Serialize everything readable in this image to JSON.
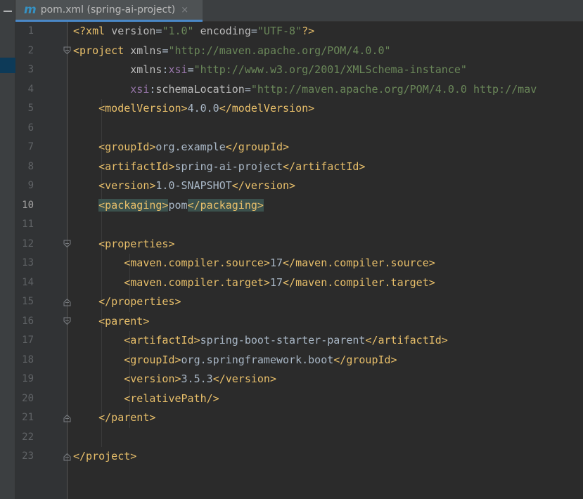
{
  "tab": {
    "icon": "maven-m-icon",
    "icon_glyph": "m",
    "label": "pom.xml (spring-ai-project)",
    "close_glyph": "×"
  },
  "colors": {
    "background": "#2b2b2b",
    "tag": "#e8bf6a",
    "attribute": "#bababa",
    "namespace": "#9876aa",
    "value": "#6a8759",
    "text": "#a9b7c6",
    "tag_match_highlight": "#3b514d",
    "tab_underline": "#4a88c7"
  },
  "editor": {
    "current_line": 10,
    "lines": [
      {
        "num": "1",
        "tokens": [
          {
            "t": "pi",
            "v": "<?xml "
          },
          {
            "t": "attr",
            "v": "version"
          },
          {
            "t": "txt",
            "v": "="
          },
          {
            "t": "val",
            "v": "\"1.0\""
          },
          {
            "t": "txt",
            "v": " "
          },
          {
            "t": "attr",
            "v": "encoding"
          },
          {
            "t": "txt",
            "v": "="
          },
          {
            "t": "val",
            "v": "\"UTF-8\""
          },
          {
            "t": "pi",
            "v": "?>"
          }
        ]
      },
      {
        "num": "2",
        "fold": "open",
        "tokens": [
          {
            "t": "tag",
            "v": "<project "
          },
          {
            "t": "attr",
            "v": "xmlns"
          },
          {
            "t": "txt",
            "v": "="
          },
          {
            "t": "val",
            "v": "\"http://maven.apache.org/POM/4.0.0\""
          }
        ]
      },
      {
        "num": "3",
        "tokens": [
          {
            "t": "txt",
            "v": "         "
          },
          {
            "t": "attr",
            "v": "xmlns"
          },
          {
            "t": "txt",
            "v": ":"
          },
          {
            "t": "ns",
            "v": "xsi"
          },
          {
            "t": "txt",
            "v": "="
          },
          {
            "t": "val",
            "v": "\"http://www.w3.org/2001/XMLSchema-instance\""
          }
        ]
      },
      {
        "num": "4",
        "tokens": [
          {
            "t": "txt",
            "v": "         "
          },
          {
            "t": "ns",
            "v": "xsi"
          },
          {
            "t": "txt",
            "v": ":"
          },
          {
            "t": "attr",
            "v": "schemaLocation"
          },
          {
            "t": "txt",
            "v": "="
          },
          {
            "t": "val",
            "v": "\"http://maven.apache.org/POM/4.0.0 http://mav"
          }
        ]
      },
      {
        "num": "5",
        "tokens": [
          {
            "t": "txt",
            "v": "    "
          },
          {
            "t": "tag",
            "v": "<modelVersion>"
          },
          {
            "t": "txt",
            "v": "4.0.0"
          },
          {
            "t": "tag",
            "v": "</modelVersion>"
          }
        ]
      },
      {
        "num": "6",
        "tokens": []
      },
      {
        "num": "7",
        "tokens": [
          {
            "t": "txt",
            "v": "    "
          },
          {
            "t": "tag",
            "v": "<groupId>"
          },
          {
            "t": "txt",
            "v": "org.example"
          },
          {
            "t": "tag",
            "v": "</groupId>"
          }
        ]
      },
      {
        "num": "8",
        "tokens": [
          {
            "t": "txt",
            "v": "    "
          },
          {
            "t": "tag",
            "v": "<artifactId>"
          },
          {
            "t": "txt",
            "v": "spring-ai-project"
          },
          {
            "t": "tag",
            "v": "</artifactId>"
          }
        ]
      },
      {
        "num": "9",
        "tokens": [
          {
            "t": "txt",
            "v": "    "
          },
          {
            "t": "tag",
            "v": "<version>"
          },
          {
            "t": "txt",
            "v": "1.0-SNAPSHOT"
          },
          {
            "t": "tag",
            "v": "</version>"
          }
        ]
      },
      {
        "num": "10",
        "tokens": [
          {
            "t": "txt",
            "v": "    "
          },
          {
            "t": "tag match",
            "v": "<packaging>"
          },
          {
            "t": "txt",
            "v": "pom"
          },
          {
            "t": "tag match",
            "v": "</packaging>"
          }
        ]
      },
      {
        "num": "11",
        "tokens": []
      },
      {
        "num": "12",
        "fold": "open",
        "tokens": [
          {
            "t": "txt",
            "v": "    "
          },
          {
            "t": "tag",
            "v": "<properties>"
          }
        ]
      },
      {
        "num": "13",
        "tokens": [
          {
            "t": "txt",
            "v": "        "
          },
          {
            "t": "tag",
            "v": "<maven.compiler.source>"
          },
          {
            "t": "txt",
            "v": "17"
          },
          {
            "t": "tag",
            "v": "</maven.compiler.source>"
          }
        ]
      },
      {
        "num": "14",
        "tokens": [
          {
            "t": "txt",
            "v": "        "
          },
          {
            "t": "tag",
            "v": "<maven.compiler.target>"
          },
          {
            "t": "txt",
            "v": "17"
          },
          {
            "t": "tag",
            "v": "</maven.compiler.target>"
          }
        ]
      },
      {
        "num": "15",
        "fold": "close",
        "tokens": [
          {
            "t": "txt",
            "v": "    "
          },
          {
            "t": "tag",
            "v": "</properties>"
          }
        ]
      },
      {
        "num": "16",
        "fold": "open",
        "tokens": [
          {
            "t": "txt",
            "v": "    "
          },
          {
            "t": "tag",
            "v": "<parent>"
          }
        ]
      },
      {
        "num": "17",
        "tokens": [
          {
            "t": "txt",
            "v": "        "
          },
          {
            "t": "tag",
            "v": "<artifactId>"
          },
          {
            "t": "txt",
            "v": "spring-boot-starter-parent"
          },
          {
            "t": "tag",
            "v": "</artifactId>"
          }
        ]
      },
      {
        "num": "18",
        "tokens": [
          {
            "t": "txt",
            "v": "        "
          },
          {
            "t": "tag",
            "v": "<groupId>"
          },
          {
            "t": "txt",
            "v": "org.springframework.boot"
          },
          {
            "t": "tag",
            "v": "</groupId>"
          }
        ]
      },
      {
        "num": "19",
        "tokens": [
          {
            "t": "txt",
            "v": "        "
          },
          {
            "t": "tag",
            "v": "<version>"
          },
          {
            "t": "txt",
            "v": "3.5.3"
          },
          {
            "t": "tag",
            "v": "</version>"
          }
        ]
      },
      {
        "num": "20",
        "tokens": [
          {
            "t": "txt",
            "v": "        "
          },
          {
            "t": "tag",
            "v": "<relativePath/>"
          }
        ]
      },
      {
        "num": "21",
        "fold": "close",
        "tokens": [
          {
            "t": "txt",
            "v": "    "
          },
          {
            "t": "tag",
            "v": "</parent>"
          }
        ]
      },
      {
        "num": "22",
        "tokens": []
      },
      {
        "num": "23",
        "fold": "close",
        "tokens": [
          {
            "t": "tag",
            "v": "</project>"
          }
        ]
      }
    ]
  }
}
